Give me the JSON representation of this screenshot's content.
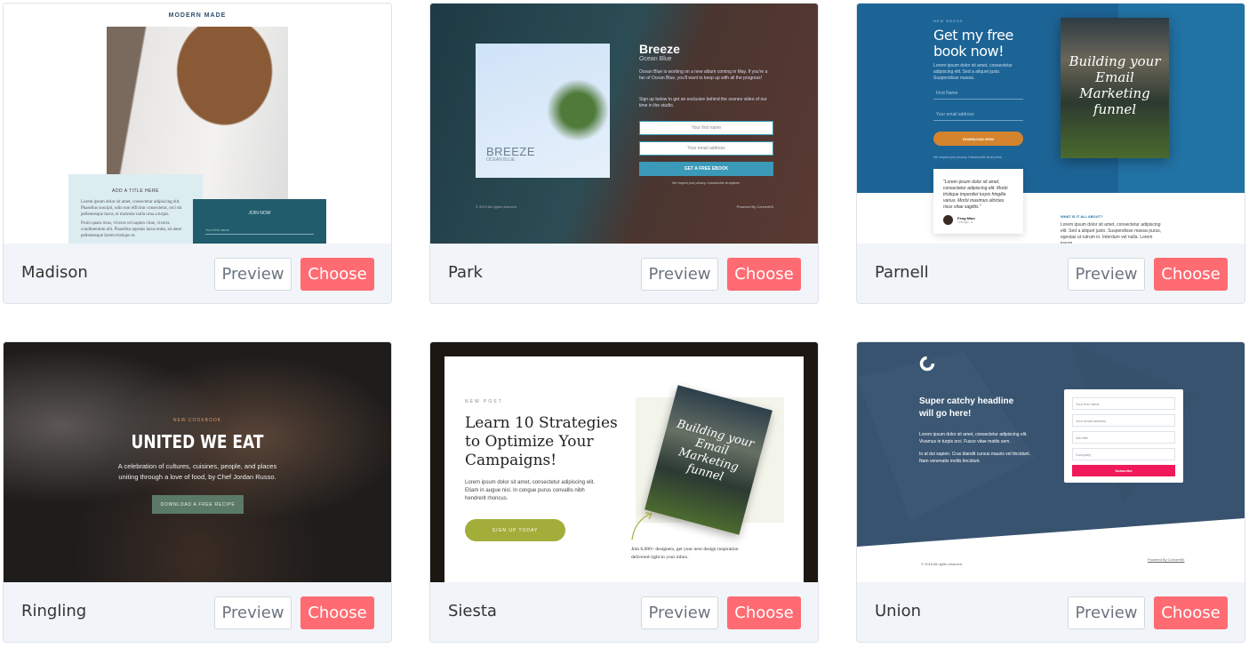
{
  "buttons": {
    "preview": "Preview",
    "choose": "Choose"
  },
  "colors": {
    "choose": "#ff6b72",
    "footer_bg": "#f1f4f8"
  },
  "templates": [
    {
      "name": "Madison",
      "thumb": {
        "brand": "MODERN MADE",
        "box_title": "ADD A TITLE HERE",
        "box_text": "Lorem ipsum dolor sit amet, consectetur adipiscing elit. Phasellus suscipit, odio non efficitur consectetur, orci mi pellentesque lacus, et molestie nulla urna a turpis.",
        "box_text2": "Proin quam risus, viverra vel sapien vitae, viverra condimentum elit. Phasellus egestas lacus enim, sit amet pellentesque lorem tristique et.",
        "join_title": "JOIN NOW",
        "join_placeholder": "Your first name"
      }
    },
    {
      "name": "Park",
      "thumb": {
        "album_title": "BREEZE",
        "album_sub": "OCEAN BLUE",
        "title": "Breeze",
        "subtitle": "Ocean Blue",
        "p1": "Ocean Blue is working on a new album coming in May. If you're a fan of Ocean Blue, you'll want to keep up with all the progress!",
        "p2": "Sign up below to get an exclusive behind the scenes video of our time in the studio.",
        "input1": "Your first name",
        "input2": "Your email address",
        "button": "GET A FREE EBOOK",
        "privacy": "We respect your privacy. Unsubscribe at anytime.",
        "copyright": "© 2019 All rights reserved",
        "powered": "Powered By ConvertKit"
      }
    },
    {
      "name": "Parnell",
      "thumb": {
        "eyebrow": "NEW EBOOK",
        "headline": "Get my free book now!",
        "lorem": "Lorem ipsum dolor sit amet, consectetur adipiscing elit. Sed a aliquet justo. Suspendisse massa.",
        "input1": "First Name",
        "input2": "Your email address",
        "button": "DOWNLOAD NOW",
        "privacy": "We respect your privacy. Unsubscribe at any time.",
        "quote": "\"Lorem ipsum dolor sit amet, consectetur adipiscing elit. Morbi tristique imperdiet turpis fringilla varius. Morbi maximus ultricies risus vitae sagittis.\"",
        "author": "Feng Mian",
        "location": "Chicago, IL",
        "section_title": "WHAT IS IT ALL ABOUT?",
        "section_text": "Lorem ipsum dolor sit amet, consectetur adipiscing elit. Sed a aliquet justo. Suspendisse massa purus, egestas ut rutrum in. Interdum vel nulla. Lorem ipsum",
        "book_title": "Building your Email Marketing funnel"
      }
    },
    {
      "name": "Ringling",
      "thumb": {
        "eyebrow": "NEW COOKBOOK",
        "headline": "UNITED WE EAT",
        "text": "A celebration of cultures, cuisines, people, and places uniting through a love of food, by Chef Jordan Russo.",
        "button": "DOWNLOAD A FREE RECIPE"
      }
    },
    {
      "name": "Siesta",
      "thumb": {
        "eyebrow": "NEW POST",
        "headline": "Learn 10 Strategies to Optimize Your Campaigns!",
        "text": "Lorem ipsum dolor sit amet, consectetur adipiscing elit. Etiam in augue nisl. In congue purus convallis nibh hendrerit rhoncus.",
        "button": "SIGN UP TODAY",
        "caption": "Join 6,000+ designers, get your next design inspiration delivered right to your inbox.",
        "book_title": "Building your Email Marketing funnel"
      }
    },
    {
      "name": "Union",
      "thumb": {
        "headline": "Super catchy headline will go here!",
        "p1": "Lorem ipsum dolor sit amet, consectetur adipiscing elit. Vivamus in turpis orci. Fusce vitae mattis sem.",
        "p2": "In at dui sapien. Cras blandit cursus mauris vel tincidunt. Nam venenatis mollis tincidunt.",
        "input1": "Your first name",
        "input2": "Your email address",
        "input3": "Job title",
        "input4": "Company",
        "button": "Subscribe",
        "copyright": "© 2018 All rights reserved.",
        "powered": "Powered By ConvertKit"
      }
    }
  ]
}
